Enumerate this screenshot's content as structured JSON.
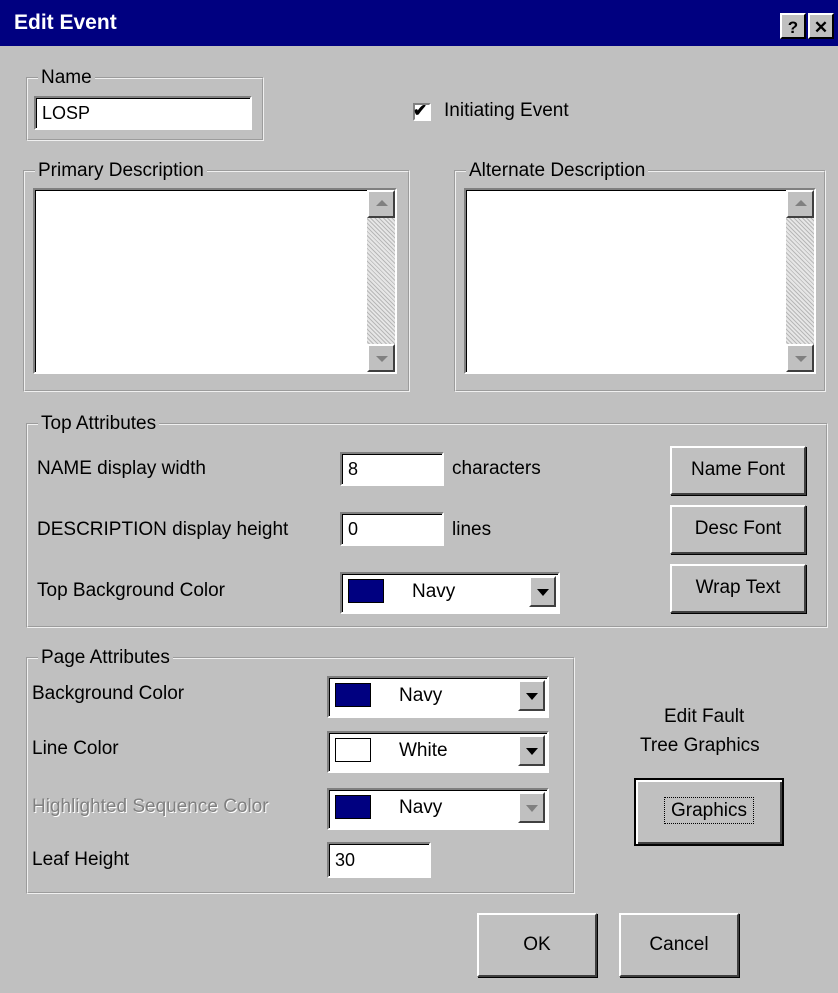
{
  "window": {
    "title": "Edit Event",
    "help_button": "?",
    "close_button": "✕"
  },
  "name_group": {
    "label": "Name",
    "value": "LOSP"
  },
  "initiating_event": {
    "label": "Initiating Event",
    "checked": true
  },
  "primary_description": {
    "label": "Primary Description",
    "value": ""
  },
  "alternate_description": {
    "label": "Alternate Description",
    "value": ""
  },
  "top_attributes": {
    "label": "Top Attributes",
    "name_width_label": "NAME display width",
    "name_width_value": "8",
    "name_width_unit": "characters",
    "desc_height_label": "DESCRIPTION display height",
    "desc_height_value": "0",
    "desc_height_unit": "lines",
    "bg_color_label": "Top Background Color",
    "bg_color_value": "Navy",
    "bg_color_swatch": "#000080",
    "name_font_button": "Name Font",
    "desc_font_button": "Desc Font",
    "wrap_text_button": "Wrap Text"
  },
  "page_attributes": {
    "label": "Page Attributes",
    "bg_color_label": "Background Color",
    "bg_color_value": "Navy",
    "bg_color_swatch": "#000080",
    "line_color_label": "Line Color",
    "line_color_value": "White",
    "line_color_swatch": "#ffffff",
    "highlight_label": "Highlighted Sequence Color",
    "highlight_value": "Navy",
    "highlight_swatch": "#000080",
    "leaf_height_label": "Leaf Height",
    "leaf_height_value": "30"
  },
  "graphics": {
    "caption_line1": "Edit Fault",
    "caption_line2": "Tree Graphics",
    "button": "Graphics"
  },
  "footer": {
    "ok_button": "OK",
    "cancel_button": "Cancel"
  }
}
